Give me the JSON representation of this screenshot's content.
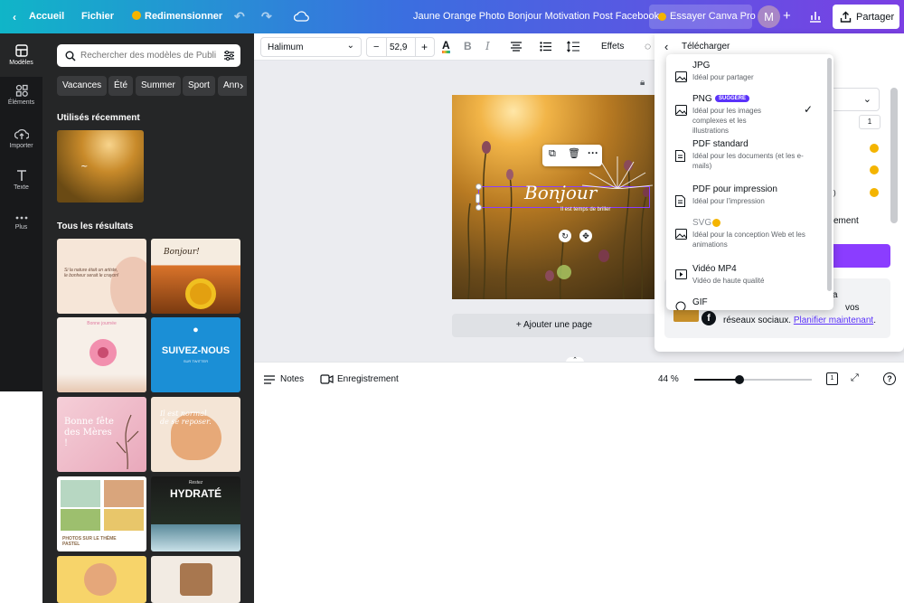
{
  "header": {
    "back_label": "Accueil",
    "file_label": "Fichier",
    "resize_label": "Redimensionner",
    "doc_title": "Jaune Orange Photo Bonjour Motivation Post Facebook",
    "pro_label": "Essayer Canva Pro",
    "avatar_letter": "M",
    "share_label": "Partager"
  },
  "rail": {
    "items": [
      {
        "label": "Modèles"
      },
      {
        "label": "Éléments"
      },
      {
        "label": "Importer"
      },
      {
        "label": "Texte"
      },
      {
        "label": "Plus"
      }
    ]
  },
  "panel": {
    "search_placeholder": "Rechercher des modèles de Publi",
    "chips": [
      "Vacances",
      "Été",
      "Summer",
      "Sport",
      "Ann"
    ],
    "recent_title": "Utilisés récemment",
    "results_title": "Tous les résultats",
    "templates": {
      "t1": "Si la nature était un artiste, le bonheur serait le crayon!",
      "t2": "Bonjour!",
      "t3": "Bonne journée",
      "t4": "SUIVEZ-NOUS",
      "t4b": "SUR TWITTER",
      "t5": "Bonne fête des Mères !",
      "t6": "Il est normal de se reposer.",
      "t7": "PHOTOS SUR LE THÈME PASTEL",
      "t8": "HYDRATÉ",
      "t8b": "Restez"
    }
  },
  "toolbar": {
    "font": "Halimum",
    "size": "52,9",
    "effects_label": "Effets"
  },
  "canvas": {
    "headline": "Bonjour",
    "subline": "Il est temps de briller",
    "add_page_label": "+ Ajouter une page"
  },
  "footer": {
    "notes_label": "Notes",
    "recording_label": "Enregistrement",
    "zoom": "44 %"
  },
  "download": {
    "title": "Télécharger",
    "size_value": "1",
    "post_text_line1": "a",
    "post_text_line2": "vos",
    "post_text_line3": "réseaux sociaux.",
    "plan_link": "Planifier maintenant",
    "plan_suffix": ".",
    "options": [
      {
        "name": "JPG",
        "desc": "Idéal pour partager"
      },
      {
        "name": "PNG",
        "badge": "SUGGÉRÉ",
        "desc": "Idéal pour les images complexes et les illustrations",
        "selected": true
      },
      {
        "name": "PDF standard",
        "desc": "Idéal pour les documents (et les e-mails)"
      },
      {
        "name": "PDF pour impression",
        "desc": "Idéal pour l'impression"
      },
      {
        "name": "SVG",
        "desc": "Idéal pour la conception Web et les animations"
      },
      {
        "name": "Vidéo MP4",
        "desc": "Vidéo de haute qualité"
      },
      {
        "name": "GIF",
        "desc": ""
      }
    ]
  },
  "colors": {
    "accent": "#8b3dff",
    "brand_gradient_start": "#10b5c8",
    "brand_gradient_end": "#7b3fe4",
    "crown": "#f4b400",
    "panel_bg": "#252627"
  }
}
